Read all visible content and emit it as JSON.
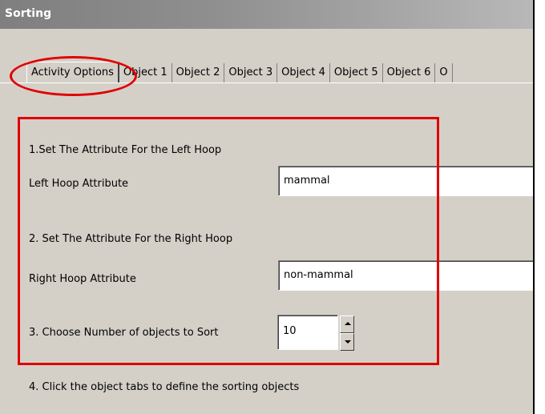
{
  "window": {
    "title": "Sorting"
  },
  "tabs": [
    {
      "label": "Activity Options",
      "active": true
    },
    {
      "label": "Object 1"
    },
    {
      "label": "Object 2"
    },
    {
      "label": "Object 3"
    },
    {
      "label": "Object 4"
    },
    {
      "label": "Object 5"
    },
    {
      "label": "Object 6"
    },
    {
      "label": "O"
    }
  ],
  "form": {
    "step1_heading": "1.Set The Attribute For the Left Hoop",
    "left_label": "Left Hoop Attribute",
    "left_value": "mammal",
    "step2_heading": "2. Set The Attribute For the Right Hoop",
    "right_label": "Right Hoop Attribute",
    "right_value": "non-mammal",
    "step3_label": "3. Choose Number of objects to Sort",
    "count_value": "10",
    "step4_text": "4. Click the object tabs to define the sorting objects"
  },
  "annotation_colors": {
    "highlight": "#e00000"
  }
}
